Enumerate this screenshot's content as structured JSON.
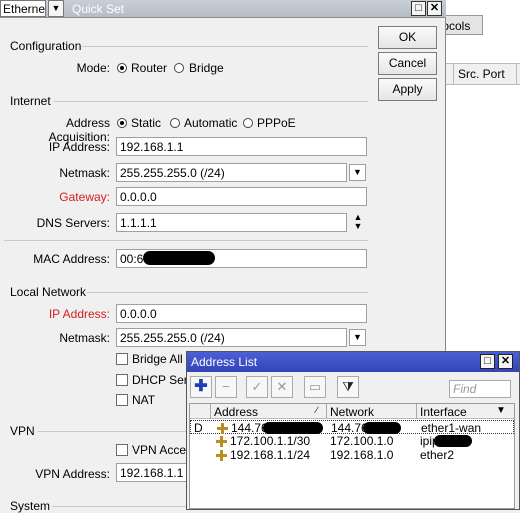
{
  "background_window": {
    "tab_label": "tocols",
    "column_src_port": "Src. Port"
  },
  "quickset": {
    "interface_mode": "Ethernet",
    "title": "Quick Set",
    "configuration": {
      "heading": "Configuration",
      "mode_label": "Mode:",
      "mode_options": [
        "Router",
        "Bridge"
      ],
      "mode_selected": "Router"
    },
    "internet": {
      "heading": "Internet",
      "acquisition_label": "Address Acquisition:",
      "acquisition_options": [
        "Static",
        "Automatic",
        "PPPoE"
      ],
      "acquisition_selected": "Static",
      "ip_label": "IP Address:",
      "ip_value": "192.168.1.1",
      "netmask_label": "Netmask:",
      "netmask_value": "255.255.255.0 (/24)",
      "gateway_label": "Gateway:",
      "gateway_value": "0.0.0.0",
      "dns_label": "DNS Servers:",
      "dns_value": "1.1.1.1",
      "mac_label": "MAC Address:",
      "mac_value": "00:60"
    },
    "local_network": {
      "heading": "Local Network",
      "ip_label": "IP Address:",
      "ip_value": "0.0.0.0",
      "netmask_label": "Netmask:",
      "netmask_value": "255.255.255.0 (/24)",
      "bridge_all_label": "Bridge All L",
      "dhcp_label": "DHCP Serv",
      "nat_label": "NAT"
    },
    "vpn": {
      "heading": "VPN",
      "access_label": "VPN Acces",
      "address_label": "VPN Address:",
      "address_value": "192.168.1.1"
    },
    "system": {
      "heading": "System"
    },
    "buttons": {
      "ok": "OK",
      "cancel": "Cancel",
      "apply": "Apply"
    }
  },
  "address_list": {
    "title": "Address List",
    "find_placeholder": "Find",
    "columns": [
      "Address",
      "Network",
      "Interface"
    ],
    "rows": [
      {
        "flag": "D",
        "address": "144.76.",
        "network": "144.76.",
        "interface": "ether1-wan"
      },
      {
        "flag": "",
        "address": "172.100.1.1/30",
        "network": "172.100.1.0",
        "interface": "ipip"
      },
      {
        "flag": "",
        "address": "192.168.1.1/24",
        "network": "192.168.1.0",
        "interface": "ether2"
      }
    ]
  },
  "colors": {
    "titlebar_active": "#3344b8",
    "titlebar_inactive": "#b5bcc6",
    "required_label": "#d42020",
    "address_icon": "#b98f22"
  }
}
